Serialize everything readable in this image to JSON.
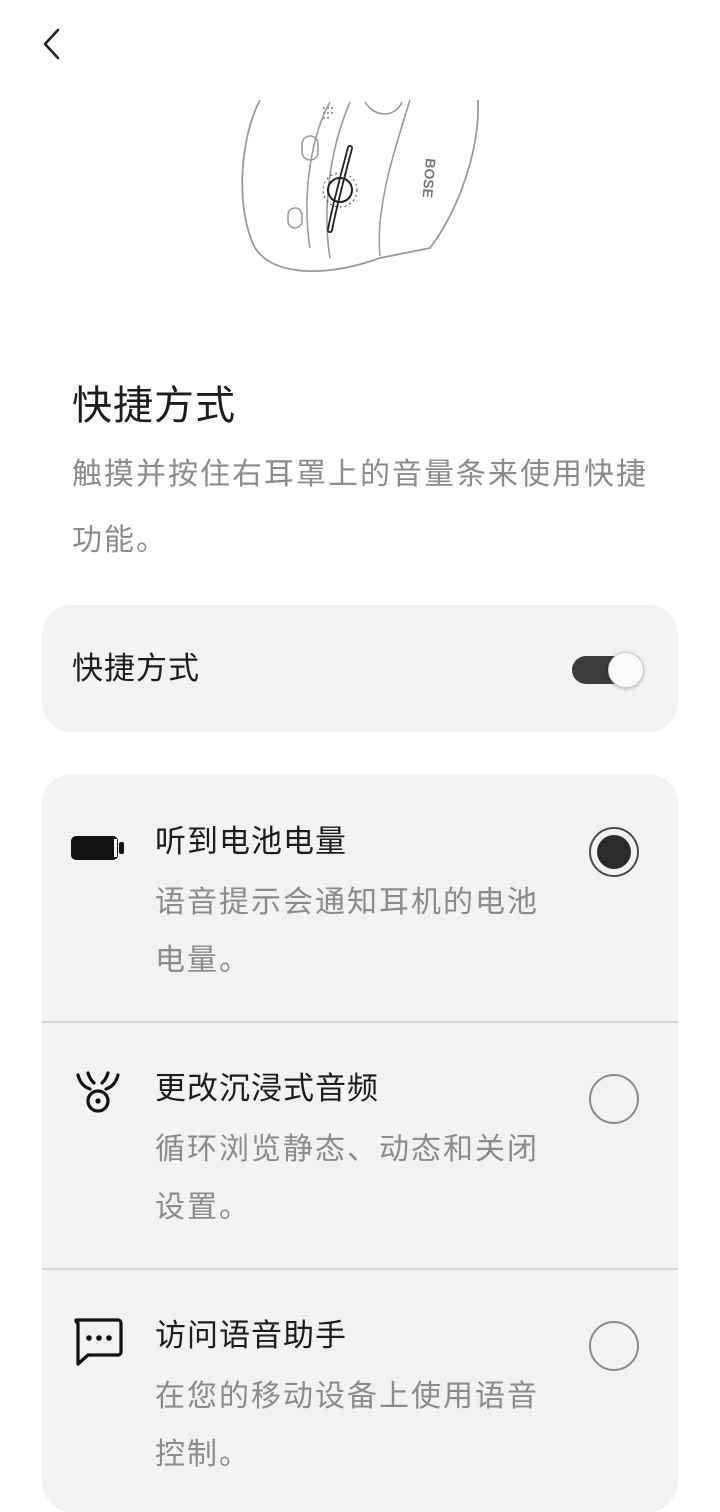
{
  "header": {
    "back_icon": "chevron-left-icon"
  },
  "illustration": {
    "brand_text": "BOSE"
  },
  "page": {
    "title": "快捷方式",
    "description": "触摸并按住右耳罩上的音量条来使用快捷功能。"
  },
  "shortcut_toggle": {
    "label": "快捷方式",
    "enabled": true
  },
  "options": [
    {
      "icon": "battery-icon",
      "title": "听到电池电量",
      "description": "语音提示会通知耳机的电池电量。",
      "selected": true
    },
    {
      "icon": "immersive-audio-icon",
      "title": "更改沉浸式音频",
      "description": "循环浏览静态、动态和关闭设置。",
      "selected": false
    },
    {
      "icon": "voice-assistant-chat-icon",
      "title": "访问语音助手",
      "description": "在您的移动设备上使用语音控制。",
      "selected": false
    }
  ],
  "colors": {
    "card_background": "#f2f2f2",
    "toggle_track_on": "#3c3c3c",
    "radio_selected": "#2b2b2b",
    "secondary_text": "#8b8b8b"
  }
}
